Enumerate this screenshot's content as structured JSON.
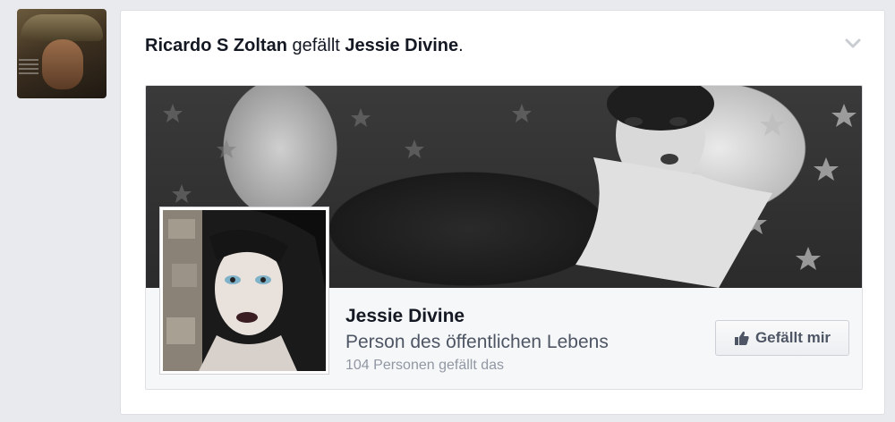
{
  "story": {
    "actor": "Ricardo S Zoltan",
    "verb": " gefällt ",
    "object": "Jessie Divine",
    "end": "."
  },
  "page_card": {
    "name": "Jessie Divine",
    "category": "Person des öffentlichen Lebens",
    "likes_text": "104 Personen gefällt das",
    "like_button_label": "Gefällt mir"
  },
  "icons": {
    "menu": "chevron-down-icon",
    "like": "thumbs-up-icon"
  },
  "colors": {
    "background": "#e9eaed",
    "text_primary": "#141823",
    "text_secondary": "#9197a3"
  }
}
